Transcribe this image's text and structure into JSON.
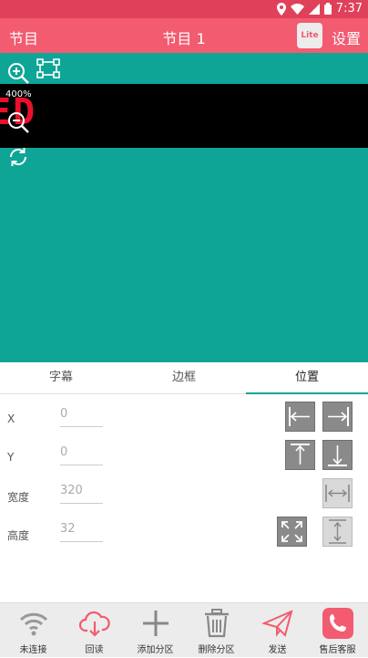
{
  "status_bar": {
    "time": "7:37"
  },
  "app_bar": {
    "left_label": "节目",
    "title": "节目 1",
    "lite_badge": "Lite",
    "settings_label": "设置"
  },
  "canvas": {
    "zoom_level": "400%",
    "led_text": "ED",
    "background_color": "#0ea596",
    "led_color": "#e8102a"
  },
  "tabs": [
    {
      "label": "字幕",
      "active": false
    },
    {
      "label": "边框",
      "active": false
    },
    {
      "label": "位置",
      "active": true
    }
  ],
  "position_form": {
    "x": {
      "label": "X",
      "value": "0"
    },
    "y": {
      "label": "Y",
      "value": "0"
    },
    "width": {
      "label": "宽度",
      "value": "320"
    },
    "height": {
      "label": "高度",
      "value": "32"
    }
  },
  "bottom_nav": [
    {
      "label": "未连接",
      "icon": "wifi-icon"
    },
    {
      "label": "回读",
      "icon": "cloud-download-icon"
    },
    {
      "label": "添加分区",
      "icon": "plus-icon"
    },
    {
      "label": "删除分区",
      "icon": "trash-icon"
    },
    {
      "label": "发送",
      "icon": "send-icon"
    },
    {
      "label": "售后客服",
      "icon": "phone-icon"
    }
  ],
  "colors": {
    "appbar": "#f25b70",
    "statusbar": "#e0415a",
    "accent": "#0ea596"
  }
}
